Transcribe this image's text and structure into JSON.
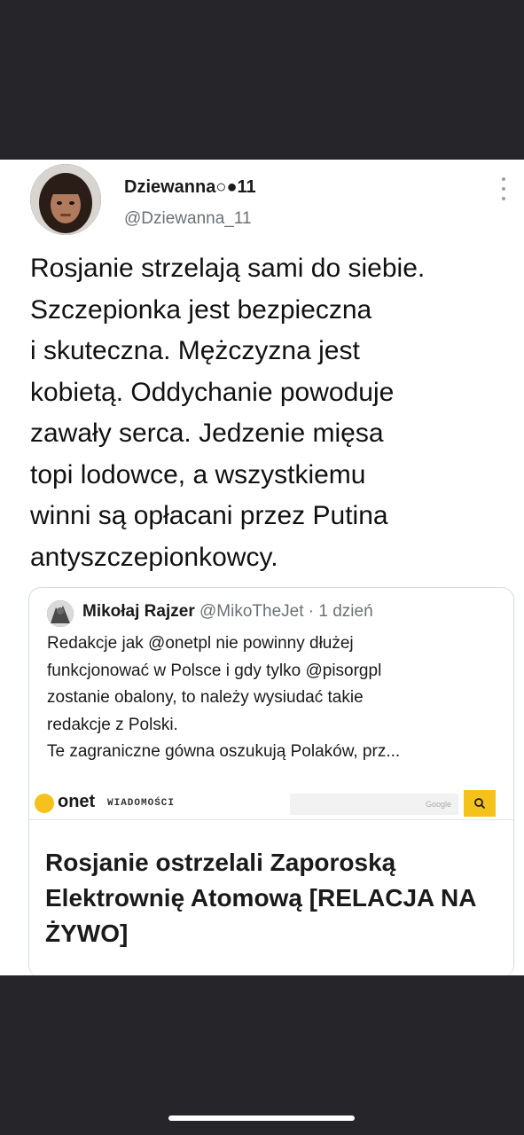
{
  "tweet": {
    "author_name": "Dziewanna○●11",
    "author_handle": "@Dziewanna_11",
    "text": "Rosjanie strzelają sami do siebie.\nSzczepionka jest bezpieczna\ni skuteczna. Mężczyzna jest\nkobietą. Oddychanie powoduje\nzawały serca. Jedzenie mięsa\ntopi lodowce, a wszystkiemu\nwinni są opłacani przez Putina\nantyszczepionkowcy.",
    "more_icon": "more-vertical-icon"
  },
  "quote": {
    "author_name": "Mikołaj Rajzer",
    "author_handle": "@MikoTheJet",
    "separator": " · ",
    "time": "1 dzień",
    "text": "Redakcje jak @onetpl nie powinny dłużej\nfunkcjonować w Polsce i gdy tylko @pisorgpl\nzostanie obalony, to należy wysiudać takie\nredakcje z Polski.\nTe zagraniczne gówna oszukują Polaków, prz..."
  },
  "article": {
    "site_logo": "onet",
    "site_section": "WIADOMOŚCI",
    "search_placeholder": "Google",
    "search_icon": "search-icon",
    "headline": "Rosjanie ostrzelali Zaporoską Elektrownię Atomową [RELACJA NA ŻYWO]"
  },
  "colors": {
    "background": "#26262a",
    "card": "#ffffff",
    "accent": "#f4c21b",
    "muted": "#6b7176"
  }
}
